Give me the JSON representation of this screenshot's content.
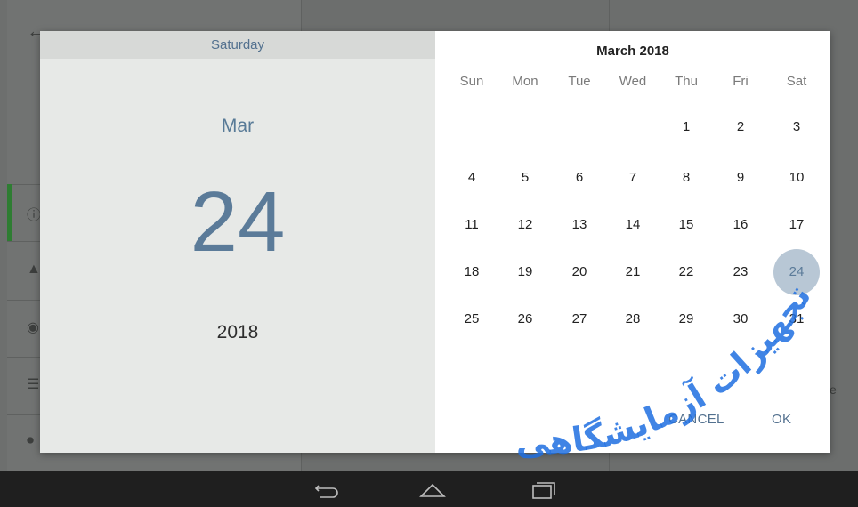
{
  "header": {
    "day_of_week": "Saturday",
    "month": "Mar",
    "day": "24",
    "year": "2018"
  },
  "calendar": {
    "title": "March 2018",
    "weekdays": [
      "Sun",
      "Mon",
      "Tue",
      "Wed",
      "Thu",
      "Fri",
      "Sat"
    ],
    "days": [
      {
        "d": "1",
        "c": 4,
        "r": 0
      },
      {
        "d": "2",
        "c": 5,
        "r": 0
      },
      {
        "d": "3",
        "c": 6,
        "r": 0
      },
      {
        "d": "4",
        "c": 0,
        "r": 1
      },
      {
        "d": "5",
        "c": 1,
        "r": 1
      },
      {
        "d": "6",
        "c": 2,
        "r": 1
      },
      {
        "d": "7",
        "c": 3,
        "r": 1
      },
      {
        "d": "8",
        "c": 4,
        "r": 1
      },
      {
        "d": "9",
        "c": 5,
        "r": 1
      },
      {
        "d": "10",
        "c": 6,
        "r": 1
      },
      {
        "d": "11",
        "c": 0,
        "r": 2
      },
      {
        "d": "12",
        "c": 1,
        "r": 2
      },
      {
        "d": "13",
        "c": 2,
        "r": 2
      },
      {
        "d": "14",
        "c": 3,
        "r": 2
      },
      {
        "d": "15",
        "c": 4,
        "r": 2
      },
      {
        "d": "16",
        "c": 5,
        "r": 2
      },
      {
        "d": "17",
        "c": 6,
        "r": 2
      },
      {
        "d": "18",
        "c": 0,
        "r": 3
      },
      {
        "d": "19",
        "c": 1,
        "r": 3
      },
      {
        "d": "20",
        "c": 2,
        "r": 3
      },
      {
        "d": "21",
        "c": 3,
        "r": 3
      },
      {
        "d": "22",
        "c": 4,
        "r": 3
      },
      {
        "d": "23",
        "c": 5,
        "r": 3
      },
      {
        "d": "24",
        "c": 6,
        "r": 3
      },
      {
        "d": "25",
        "c": 0,
        "r": 4
      },
      {
        "d": "26",
        "c": 1,
        "r": 4
      },
      {
        "d": "27",
        "c": 2,
        "r": 4
      },
      {
        "d": "28",
        "c": 3,
        "r": 4
      },
      {
        "d": "29",
        "c": 4,
        "r": 4
      },
      {
        "d": "30",
        "c": 5,
        "r": 4
      },
      {
        "d": "31",
        "c": 6,
        "r": 4
      }
    ],
    "selected_day": "24",
    "cancel_label": "CANCEL",
    "ok_label": "OK"
  },
  "background": {
    "right_edge_text": "e"
  },
  "watermark": {
    "text": "تجهیزات آزمایشگاهی"
  },
  "navbar": {
    "icons": [
      "back-icon",
      "home-icon",
      "recents-icon"
    ]
  },
  "colors": {
    "accent": "#5b7b99",
    "selected_bg": "#b8c7d5",
    "header_bg": "#e7e9e7",
    "watermark": "#1f6fe0"
  }
}
